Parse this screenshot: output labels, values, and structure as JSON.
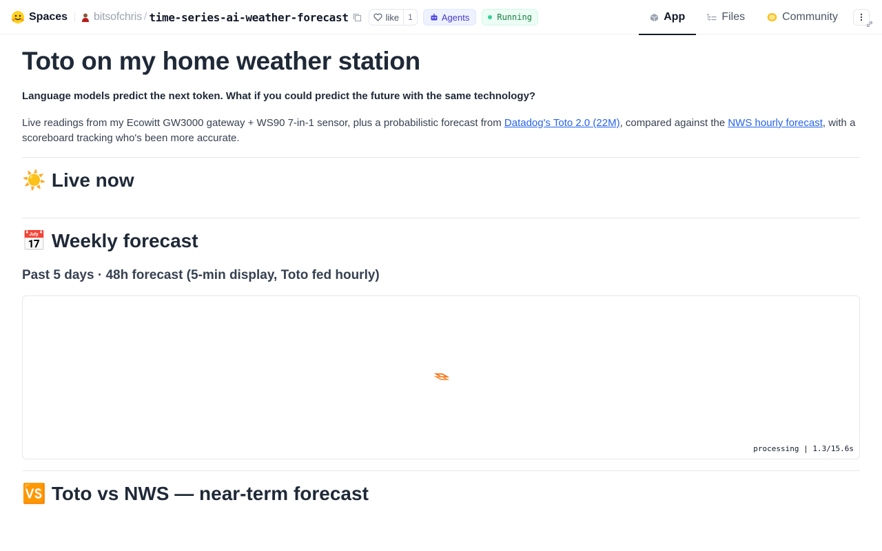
{
  "header": {
    "brand": "Spaces",
    "user": "bitsofchris",
    "separator": "/",
    "repo": "time-series-ai-weather-forecast",
    "like_label": "like",
    "like_count": "1",
    "agents_label": "Agents",
    "status": "Running",
    "tabs": [
      {
        "label": "App",
        "icon": "cube-icon",
        "active": true
      },
      {
        "label": "Files",
        "icon": "files-icon",
        "active": false
      },
      {
        "label": "Community",
        "icon": "community-icon",
        "active": false
      }
    ]
  },
  "page": {
    "title": "Toto on my home weather station",
    "tagline": "Language models predict the next token. What if you could predict the future with the same technology?",
    "intro": {
      "part1": "Live readings from my Ecowitt GW3000 gateway + WS90 7-in-1 sensor, plus a probabilistic forecast from ",
      "link1": "Datadog's Toto 2.0 (22M)",
      "part2": ", compared against the ",
      "link2": "NWS hourly forecast",
      "part3": ", with a scoreboard tracking who's been more accurate."
    }
  },
  "sections": {
    "live": {
      "emoji": "☀️",
      "title": "Live now"
    },
    "weekly": {
      "emoji": "📅",
      "title": "Weekly forecast",
      "subtitle": "Past 5 days · 48h forecast (5-min display, Toto fed hourly)",
      "status": "processing | 1.3/15.6s"
    },
    "vs": {
      "emoji": "🆚",
      "title": "Toto vs NWS — near-term forecast"
    }
  },
  "colors": {
    "accent_orange": "#f97316",
    "link": "#2563eb",
    "running_green": "#15803d",
    "agents_indigo": "#4338ca"
  }
}
